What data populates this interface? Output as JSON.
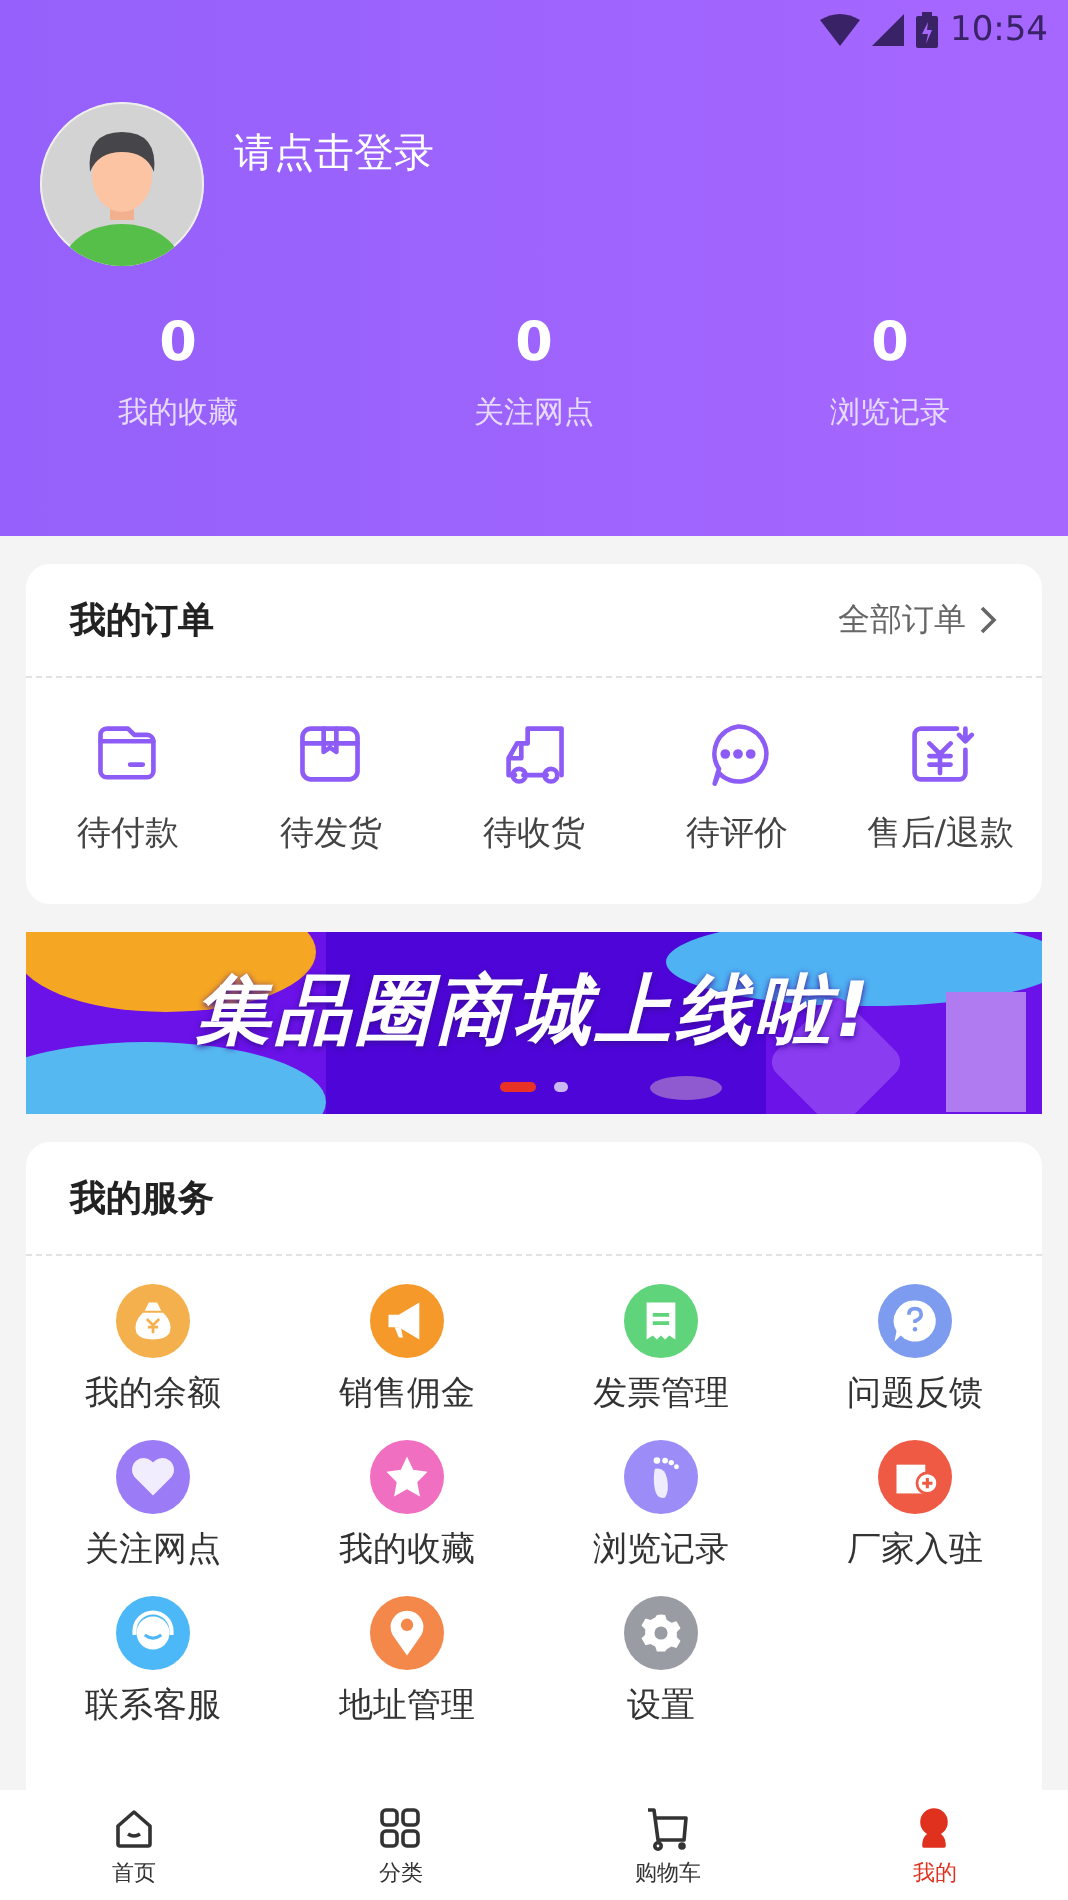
{
  "status_bar": {
    "time": "10:54"
  },
  "profile": {
    "login_prompt": "请点击登录",
    "stats": [
      {
        "value": "0",
        "label": "我的收藏"
      },
      {
        "value": "0",
        "label": "关注网点"
      },
      {
        "value": "0",
        "label": "浏览记录"
      }
    ]
  },
  "orders": {
    "title": "我的订单",
    "all_link": "全部订单",
    "items": [
      {
        "label": "待付款"
      },
      {
        "label": "待发货"
      },
      {
        "label": "待收货"
      },
      {
        "label": "待评价"
      },
      {
        "label": "售后/退款"
      }
    ]
  },
  "banner": {
    "headline": "集品圈商城上线啦!",
    "dots": [
      {
        "selected": true
      },
      {
        "selected": false
      }
    ]
  },
  "services": {
    "title": "我的服务",
    "items": [
      {
        "label": "我的余额",
        "color": "#f4b04c"
      },
      {
        "label": "销售佣金",
        "color": "#f59a2a"
      },
      {
        "label": "发票管理",
        "color": "#5fd47a"
      },
      {
        "label": "问题反馈",
        "color": "#7d9cf0"
      },
      {
        "label": "关注网点",
        "color": "#9b7cf6"
      },
      {
        "label": "我的收藏",
        "color": "#f06fc0"
      },
      {
        "label": "浏览记录",
        "color": "#9b8cf8"
      },
      {
        "label": "厂家入驻",
        "color": "#ef5a44"
      },
      {
        "label": "联系客服",
        "color": "#4cb8f8"
      },
      {
        "label": "地址管理",
        "color": "#f3884a"
      },
      {
        "label": "设置",
        "color": "#9a9ca3"
      }
    ]
  },
  "tab_bar": [
    {
      "label": "首页",
      "selected": false
    },
    {
      "label": "分类",
      "selected": false
    },
    {
      "label": "购物车",
      "selected": false
    },
    {
      "label": "我的",
      "selected": true
    }
  ]
}
